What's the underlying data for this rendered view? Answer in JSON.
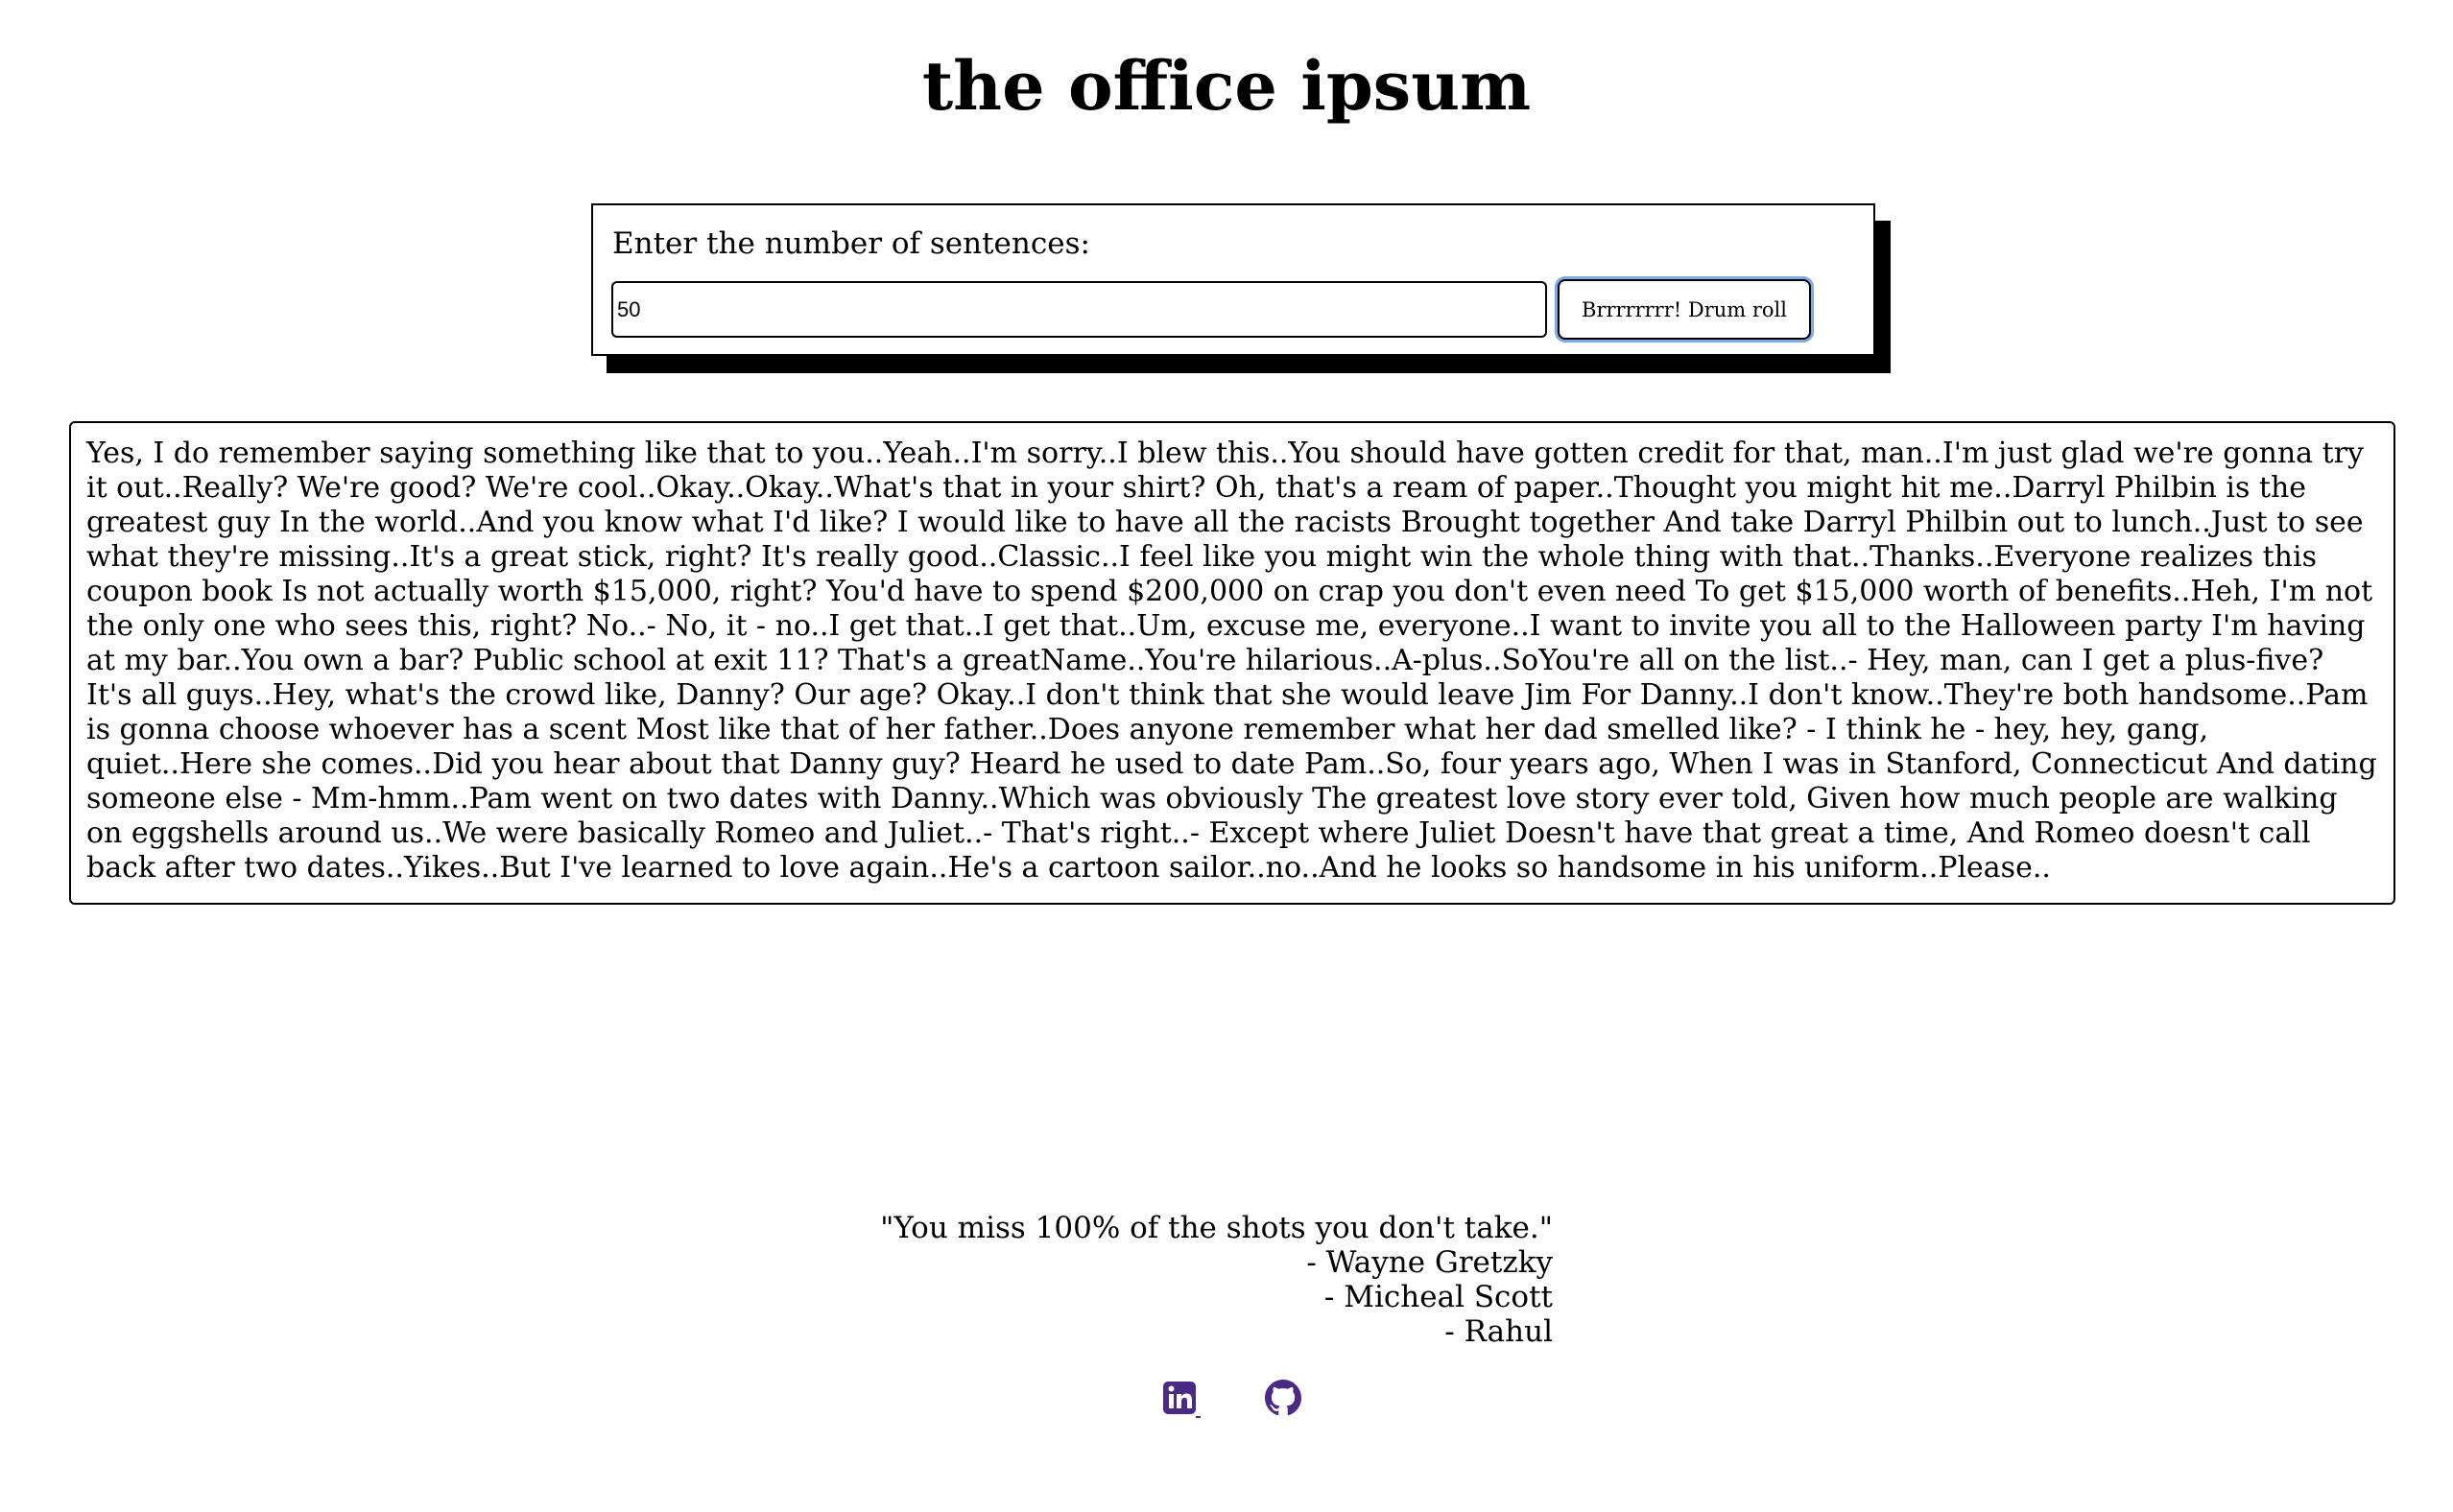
{
  "header": {
    "title": "the office ipsum"
  },
  "form": {
    "label": "Enter the number of sentences:",
    "input_value": "50",
    "button_label": "Brrrrrrrr! Drum roll"
  },
  "output": {
    "text": "Yes, I do remember saying something like that to you..Yeah..I'm sorry..I blew this..You should have gotten credit for that, man..I'm just glad we're gonna try it out..Really? We're good? We're cool..Okay..Okay..What's that in your shirt? Oh, that's a ream of paper..Thought you might hit me..Darryl Philbin is the greatest guy In the world..And you know what I'd like? I would like to have all the racists Brought together And take Darryl Philbin out to lunch..Just to see what they're missing..It's a great stick, right? It's really good..Classic..I feel like you might win the whole thing with that..Thanks..Everyone realizes this coupon book Is not actually worth $15,000, right? You'd have to spend $200,000 on crap you don't even need To get $15,000 worth of benefits..Heh, I'm not the only one who sees this, right? No..- No, it - no..I get that..I get that..Um, excuse me, everyone..I want to invite you all to the Halloween party I'm having at my bar..You own a bar? Public school at exit 11? That's a greatName..You're hilarious..A-plus..SoYou're all on the list..- Hey, man, can I get a plus-five? It's all guys..Hey, what's the crowd like, Danny? Our age? Okay..I don't think that she would leave Jim For Danny..I don't know..They're both handsome..Pam is gonna choose whoever has a scent Most like that of her father..Does anyone remember what her dad smelled like? - I think he - hey, hey, gang, quiet..Here she comes..Did you hear about that Danny guy? Heard he used to date Pam..So, four years ago, When I was in Stanford, Connecticut And dating someone else - Mm-hmm..Pam went on two dates with Danny..Which was obviously The greatest love story ever told, Given how much people are walking on eggshells around us..We were basically Romeo and Juliet..- That's right..- Except where Juliet Doesn't have that great a time, And Romeo doesn't call back after two dates..Yikes..But I've learned to love again..He's a cartoon sailor..no..And he looks so handsome in his uniform..Please.."
  },
  "quote": {
    "line1": "\"You miss 100% of the shots you don't take.\"",
    "line2": "- Wayne Gretzky",
    "line3": "- Micheal Scott",
    "line4": "- Rahul"
  },
  "socials": {
    "icons": [
      "linkedin-icon",
      "github-icon"
    ],
    "color": "#4b2a86"
  }
}
